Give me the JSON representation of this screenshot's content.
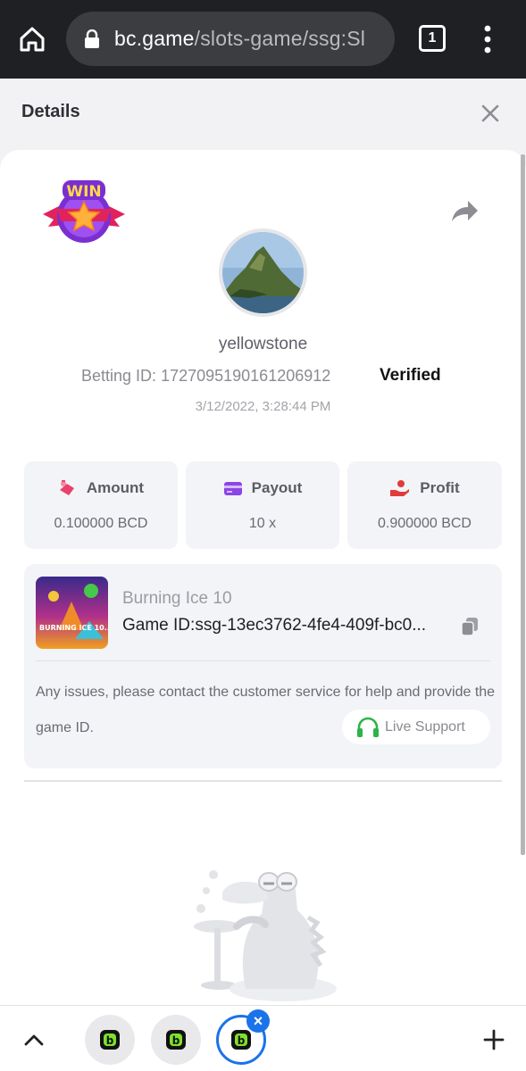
{
  "browser": {
    "url_domain": "bc.game",
    "url_path": "/slots-game/ssg:Sl",
    "tab_count": "1"
  },
  "panel": {
    "title": "Details"
  },
  "bet": {
    "username": "yellowstone",
    "betting_id_label": "Betting ID:",
    "betting_id": "1727095190161206912",
    "verified_label": "Verified",
    "datetime": "3/12/2022, 3:28:44 PM"
  },
  "stats": [
    {
      "label": "Amount",
      "value": "0.100000 BCD",
      "icon": "money-bag-icon",
      "color": "#e8436c"
    },
    {
      "label": "Payout",
      "value": "10 x",
      "icon": "card-icon",
      "color": "#8c45e6"
    },
    {
      "label": "Profit",
      "value": "0.900000 BCD",
      "icon": "profit-hand-icon",
      "color": "#e13a3a"
    }
  ],
  "game": {
    "name": "Burning Ice 10",
    "game_id_label": "Game ID:",
    "game_id": "ssg-13ec3762-4fe4-409f-bc0...",
    "thumb_text": "BURNING ICE 10...",
    "issue_text": "Any issues, please contact the customer service for help and provide the game ID.",
    "support_label": "Live Support"
  },
  "badge": {
    "text": "WIN"
  },
  "colors": {
    "accent_blue": "#1a73e8",
    "support_green": "#2cb34a"
  }
}
